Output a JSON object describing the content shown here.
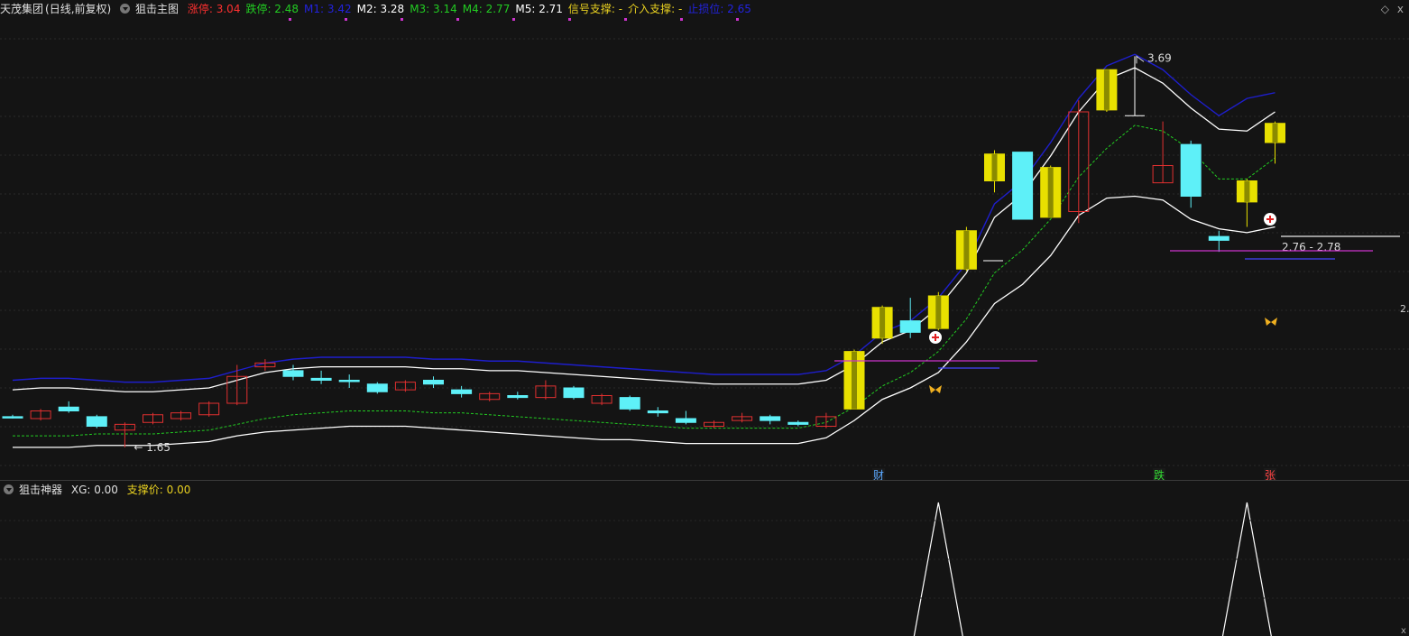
{
  "header": {
    "stock_name": "天茂集团",
    "period": "(日线,前复权)",
    "indicator": "狙击主图",
    "items": [
      {
        "label": "涨停: 3.04",
        "color": "#ff3030"
      },
      {
        "label": "跌停: 2.48",
        "color": "#22cc22"
      },
      {
        "label": "M1: 3.42",
        "color": "#2222dd"
      },
      {
        "label": "M2: 3.28",
        "color": "#ffffff"
      },
      {
        "label": "M3: 3.14",
        "color": "#22cc22"
      },
      {
        "label": "M4: 2.77",
        "color": "#22cc22"
      },
      {
        "label": "M5: 2.71",
        "color": "#ffffff"
      },
      {
        "label": "信号支撑: -",
        "color": "#e8d020"
      },
      {
        "label": "介入支撑: -",
        "color": "#e8d020"
      },
      {
        "label": "止损位: 2.65",
        "color": "#2222dd"
      }
    ]
  },
  "sub_header": {
    "indicator": "狙击神器",
    "xg": "XG: 0.00",
    "support": "支撑价: 0.00"
  },
  "window_icons": {
    "diamond": "◇",
    "close": "x"
  },
  "annotations": {
    "high_label": "3.69",
    "low_label": "1.65",
    "range_label": "2.76 - 2.78",
    "right_axis_label": "2.",
    "bottom_right_x": "x"
  },
  "markers": {
    "cai": "财",
    "die": "跌",
    "zhang": "张"
  },
  "colors": {
    "up": "#e8e000",
    "down": "#5ef0f8",
    "red": "#e03030",
    "m1": "#1e1ecc",
    "m2": "#ffffff",
    "m3": "#22cc22",
    "purple": "#cc33cc"
  },
  "chart_data": {
    "type": "candlestick",
    "candles": [
      {
        "o": 1.81,
        "c": 1.81,
        "h": 1.82,
        "l": 1.8,
        "k": "d"
      },
      {
        "o": 1.8,
        "c": 1.84,
        "h": 1.85,
        "l": 1.79,
        "k": "r"
      },
      {
        "o": 1.86,
        "c": 1.84,
        "h": 1.89,
        "l": 1.83,
        "k": "d"
      },
      {
        "o": 1.81,
        "c": 1.76,
        "h": 1.82,
        "l": 1.75,
        "k": "d"
      },
      {
        "o": 1.74,
        "c": 1.77,
        "h": 1.78,
        "l": 1.65,
        "k": "r"
      },
      {
        "o": 1.78,
        "c": 1.82,
        "h": 1.83,
        "l": 1.77,
        "k": "r"
      },
      {
        "o": 1.8,
        "c": 1.83,
        "h": 1.84,
        "l": 1.79,
        "k": "r"
      },
      {
        "o": 1.82,
        "c": 1.88,
        "h": 1.89,
        "l": 1.81,
        "k": "r"
      },
      {
        "o": 1.88,
        "c": 2.02,
        "h": 2.08,
        "l": 1.87,
        "k": "r"
      },
      {
        "o": 2.07,
        "c": 2.09,
        "h": 2.11,
        "l": 2.05,
        "k": "r"
      },
      {
        "o": 2.05,
        "c": 2.02,
        "h": 2.08,
        "l": 2.0,
        "k": "d"
      },
      {
        "o": 2.01,
        "c": 2.0,
        "h": 2.05,
        "l": 1.98,
        "k": "d"
      },
      {
        "o": 2.0,
        "c": 2.0,
        "h": 2.03,
        "l": 1.96,
        "k": "d"
      },
      {
        "o": 1.98,
        "c": 1.94,
        "h": 1.99,
        "l": 1.93,
        "k": "d"
      },
      {
        "o": 1.95,
        "c": 1.99,
        "h": 2.0,
        "l": 1.94,
        "k": "r"
      },
      {
        "o": 2.0,
        "c": 1.98,
        "h": 2.02,
        "l": 1.96,
        "k": "d"
      },
      {
        "o": 1.95,
        "c": 1.93,
        "h": 1.97,
        "l": 1.91,
        "k": "d"
      },
      {
        "o": 1.9,
        "c": 1.93,
        "h": 1.94,
        "l": 1.89,
        "k": "r"
      },
      {
        "o": 1.92,
        "c": 1.91,
        "h": 1.94,
        "l": 1.9,
        "k": "d"
      },
      {
        "o": 1.91,
        "c": 1.97,
        "h": 2.0,
        "l": 1.9,
        "k": "r"
      },
      {
        "o": 1.96,
        "c": 1.91,
        "h": 1.97,
        "l": 1.9,
        "k": "d"
      },
      {
        "o": 1.88,
        "c": 1.92,
        "h": 1.93,
        "l": 1.87,
        "k": "r"
      },
      {
        "o": 1.91,
        "c": 1.85,
        "h": 1.92,
        "l": 1.84,
        "k": "d"
      },
      {
        "o": 1.84,
        "c": 1.83,
        "h": 1.86,
        "l": 1.81,
        "k": "d"
      },
      {
        "o": 1.8,
        "c": 1.78,
        "h": 1.84,
        "l": 1.77,
        "k": "d"
      },
      {
        "o": 1.76,
        "c": 1.78,
        "h": 1.79,
        "l": 1.75,
        "k": "r"
      },
      {
        "o": 1.79,
        "c": 1.81,
        "h": 1.83,
        "l": 1.78,
        "k": "r"
      },
      {
        "o": 1.81,
        "c": 1.79,
        "h": 1.82,
        "l": 1.77,
        "k": "d"
      },
      {
        "o": 1.78,
        "c": 1.77,
        "h": 1.79,
        "l": 1.76,
        "k": "d"
      },
      {
        "o": 1.76,
        "c": 1.81,
        "h": 1.83,
        "l": 1.75,
        "k": "r"
      },
      {
        "o": 1.85,
        "c": 2.15,
        "h": 2.16,
        "l": 1.85,
        "k": "u"
      },
      {
        "o": 2.22,
        "c": 2.38,
        "h": 2.39,
        "l": 2.19,
        "k": "u"
      },
      {
        "o": 2.31,
        "c": 2.25,
        "h": 2.43,
        "l": 2.22,
        "k": "d"
      },
      {
        "o": 2.27,
        "c": 2.44,
        "h": 2.46,
        "l": 2.26,
        "k": "u"
      },
      {
        "o": 2.58,
        "c": 2.78,
        "h": 2.8,
        "l": 2.57,
        "k": "u"
      },
      {
        "o": 3.04,
        "c": 3.18,
        "h": 3.2,
        "l": 2.98,
        "k": "u"
      },
      {
        "o": 3.19,
        "c": 2.84,
        "h": 3.19,
        "l": 2.84,
        "k": "d"
      },
      {
        "o": 2.85,
        "c": 3.11,
        "h": 3.12,
        "l": 2.85,
        "k": "u"
      },
      {
        "o": 2.88,
        "c": 3.4,
        "h": 3.46,
        "l": 2.82,
        "k": "r"
      },
      {
        "o": 3.41,
        "c": 3.62,
        "h": 3.62,
        "l": 3.4,
        "k": "u"
      },
      {
        "o": 3.38,
        "c": 3.38,
        "h": 3.69,
        "l": 3.38,
        "k": "w"
      },
      {
        "o": 3.03,
        "c": 3.12,
        "h": 3.35,
        "l": 3.03,
        "k": "r"
      },
      {
        "o": 3.23,
        "c": 2.96,
        "h": 3.25,
        "l": 2.9,
        "k": "d"
      },
      {
        "o": 2.75,
        "c": 2.73,
        "h": 2.78,
        "l": 2.67,
        "k": "d"
      },
      {
        "o": 2.93,
        "c": 3.04,
        "h": 3.05,
        "l": 2.8,
        "k": "u"
      },
      {
        "o": 3.24,
        "c": 3.34,
        "h": 3.35,
        "l": 3.13,
        "k": "u"
      }
    ],
    "m1": [
      2.0,
      2.01,
      2.01,
      2.0,
      1.99,
      1.99,
      2.0,
      2.01,
      2.05,
      2.09,
      2.11,
      2.12,
      2.12,
      2.12,
      2.12,
      2.11,
      2.11,
      2.1,
      2.1,
      2.09,
      2.08,
      2.07,
      2.06,
      2.05,
      2.04,
      2.03,
      2.03,
      2.03,
      2.03,
      2.05,
      2.13,
      2.25,
      2.31,
      2.43,
      2.61,
      2.92,
      3.04,
      3.24,
      3.47,
      3.64,
      3.7,
      3.62,
      3.49,
      3.38,
      3.47,
      3.5
    ],
    "m2": [
      1.95,
      1.96,
      1.96,
      1.95,
      1.94,
      1.94,
      1.95,
      1.96,
      2.0,
      2.04,
      2.06,
      2.07,
      2.07,
      2.07,
      2.07,
      2.06,
      2.06,
      2.05,
      2.05,
      2.04,
      2.03,
      2.02,
      2.01,
      2.0,
      1.99,
      1.98,
      1.98,
      1.98,
      1.98,
      2.0,
      2.08,
      2.2,
      2.26,
      2.38,
      2.56,
      2.85,
      2.97,
      3.17,
      3.4,
      3.57,
      3.63,
      3.55,
      3.42,
      3.31,
      3.3,
      3.4
    ],
    "m3": [
      1.71,
      1.71,
      1.71,
      1.72,
      1.72,
      1.72,
      1.73,
      1.74,
      1.77,
      1.8,
      1.82,
      1.83,
      1.84,
      1.84,
      1.84,
      1.83,
      1.83,
      1.82,
      1.81,
      1.8,
      1.79,
      1.78,
      1.77,
      1.76,
      1.75,
      1.75,
      1.75,
      1.75,
      1.75,
      1.78,
      1.86,
      1.97,
      2.04,
      2.15,
      2.32,
      2.56,
      2.68,
      2.84,
      3.06,
      3.21,
      3.33,
      3.3,
      3.2,
      3.05,
      3.05,
      3.16
    ],
    "m5": [
      1.65,
      1.65,
      1.65,
      1.66,
      1.66,
      1.66,
      1.67,
      1.68,
      1.71,
      1.73,
      1.74,
      1.75,
      1.76,
      1.76,
      1.76,
      1.75,
      1.74,
      1.73,
      1.72,
      1.71,
      1.7,
      1.69,
      1.69,
      1.68,
      1.67,
      1.67,
      1.67,
      1.67,
      1.67,
      1.7,
      1.79,
      1.9,
      1.96,
      2.04,
      2.2,
      2.4,
      2.5,
      2.65,
      2.86,
      2.95,
      2.96,
      2.94,
      2.84,
      2.79,
      2.77,
      2.8
    ],
    "ylim": [
      1.56,
      3.88
    ],
    "xg": [
      0,
      0,
      0,
      0,
      0,
      0,
      0,
      0,
      0,
      0,
      0,
      0,
      0,
      0,
      0,
      0,
      0,
      0,
      0,
      0,
      0,
      0,
      0,
      0,
      0,
      0,
      0,
      0,
      0,
      0,
      0,
      0,
      0,
      1,
      0,
      0,
      0,
      0,
      0,
      0,
      0,
      0,
      0,
      0,
      1,
      0
    ]
  }
}
